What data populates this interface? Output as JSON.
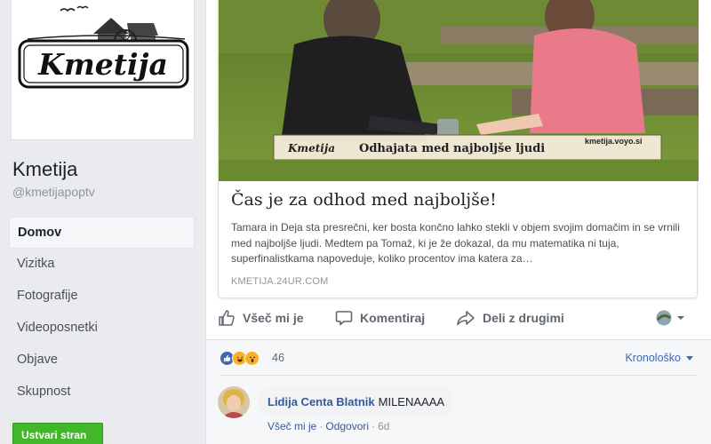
{
  "page": {
    "logo_text": "Kmetija",
    "name": "Kmetija",
    "handle": "@kmetijapoptv"
  },
  "nav": {
    "items": [
      {
        "label": "Domov",
        "active": true
      },
      {
        "label": "Vizitka"
      },
      {
        "label": "Fotografije"
      },
      {
        "label": "Videoposnetki"
      },
      {
        "label": "Objave"
      },
      {
        "label": "Skupnost"
      }
    ],
    "create_page_label": "Ustvari stran"
  },
  "link_preview": {
    "banner_logo": "Kmetija",
    "banner_caption": "Odhajata med najboljše ljudi",
    "banner_site": "kmetija.voyo.si",
    "title": "Čas je za odhod med najboljše!",
    "description": "Tamara in Deja sta presrečni, ker bosta končno lahko stekli v objem svojim domačim in se vrnili med najboljše ljudi. Medtem pa Tomaž, ki je že dokazal, da mu matematika ni tuja, superfinalistkama napoveduje, koliko procentov ima katera za…",
    "domain": "KMETIJA.24UR.COM"
  },
  "actions": {
    "like": "Všeč mi je",
    "comment": "Komentiraj",
    "share": "Deli z drugimi"
  },
  "reactions": {
    "count": "46",
    "sort_label": "Kronološko",
    "colors": {
      "like": "#4267b2",
      "haha": "#f7b125",
      "wow": "#f7b125"
    }
  },
  "comment": {
    "author": "Lidija Centa Blatnik",
    "text": "MILENAAAA",
    "like_label": "Všeč mi je",
    "reply_label": "Odgovori",
    "time": "6d"
  }
}
